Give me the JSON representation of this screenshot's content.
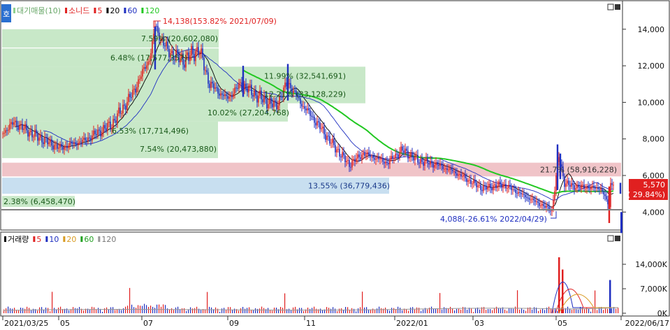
{
  "header": {
    "badge": "호",
    "legend": [
      {
        "label": "대기매물(10)",
        "color": "#8fd08f"
      },
      {
        "label": "소니드",
        "color": "#e02020"
      },
      {
        "label": "5",
        "color": "#e02020"
      },
      {
        "label": "20",
        "color": "#000000"
      },
      {
        "label": "60",
        "color": "#1f2fc0"
      },
      {
        "label": "120",
        "color": "#22c822"
      }
    ]
  },
  "volume_header": {
    "legend": [
      {
        "label": "거래량",
        "color": "#000000"
      },
      {
        "label": "5",
        "color": "#e02020"
      },
      {
        "label": "10",
        "color": "#1f2fc0"
      },
      {
        "label": "20",
        "color": "#d89a20"
      },
      {
        "label": "60",
        "color": "#22a022"
      },
      {
        "label": "120",
        "color": "#999999"
      }
    ]
  },
  "price_axis": {
    "ticks": [
      "14,000",
      "12,000",
      "10,000",
      "8,000",
      "6,000",
      "4,000"
    ]
  },
  "volume_axis": {
    "ticks": [
      "14,000K",
      "7,000K",
      "0K"
    ]
  },
  "date_axis": {
    "ticks": [
      "2021/03/25",
      "05",
      "07",
      "09",
      "11",
      "2022/01",
      "03",
      "05",
      "2022/06/17"
    ]
  },
  "annotations": {
    "high": "14,138(153.82% 2021/07/09)",
    "low": "4,088(-26.61% 2022/04/29)"
  },
  "current_price": {
    "value": "5,570",
    "change": "( 29.84%)"
  },
  "chart_data": {
    "type": "line",
    "price_panel": {
      "ylim": [
        3400,
        15000
      ],
      "x": [
        "2021/03/25",
        "2021/05",
        "2021/07",
        "2021/07/09",
        "2021/09",
        "2021/11",
        "2022/01",
        "2022/03",
        "2022/04/29",
        "2022/05",
        "2022/06/17"
      ],
      "series": [
        {
          "name": "소니드",
          "values": [
            8200,
            7600,
            10500,
            14138,
            10600,
            10000,
            7000,
            5900,
            4088,
            7000,
            5570
          ]
        }
      ],
      "volume_profile": [
        {
          "label": "7.59% (20,602,080)",
          "price_low": 13000,
          "price_high": 14000,
          "color": "#c8e8c8"
        },
        {
          "label": "6.48% (17,577,357)",
          "price_low": 11950,
          "price_high": 12950,
          "color": "#c8e8c8"
        },
        {
          "label": "11.99% (32,541,691)",
          "price_low": 10950,
          "price_high": 11950,
          "color": "#c8e8c8"
        },
        {
          "label": "12.21% (33,128,229)",
          "price_low": 9950,
          "price_high": 10950,
          "color": "#c8e8c8"
        },
        {
          "label": "10.02% (27,204,768)",
          "price_low": 8950,
          "price_high": 9950,
          "color": "#c8e8c8"
        },
        {
          "label": "6.53% (17,714,496)",
          "price_low": 7950,
          "price_high": 8950,
          "color": "#c8e8c8"
        },
        {
          "label": "7.54% (20,473,880)",
          "price_low": 6950,
          "price_high": 7950,
          "color": "#c8e8c8"
        },
        {
          "label": "21.7% (58,916,228)",
          "price_low": 5950,
          "price_high": 6700,
          "color": "#f0c4c8"
        },
        {
          "label": "13.55% (36,779,436)",
          "price_low": 5000,
          "price_high": 5880,
          "color": "#c8dff0"
        },
        {
          "label": "2.38% (6,458,470)",
          "price_low": 4280,
          "price_high": 4880,
          "color": "#c8e8c8"
        }
      ]
    },
    "volume_panel": {
      "type": "bar",
      "ylim": [
        0,
        17000
      ],
      "unit": "K",
      "spikes": [
        {
          "x": "2022/05",
          "value": 16000
        },
        {
          "x": "2022/05",
          "value": 12500
        },
        {
          "x": "2022/06/17",
          "value": 9500
        }
      ]
    }
  }
}
